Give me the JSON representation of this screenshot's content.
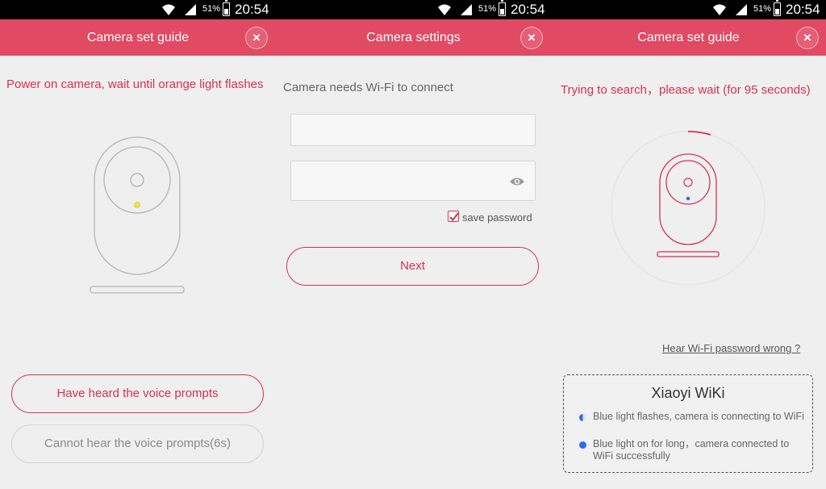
{
  "status_bar": {
    "battery": "51%",
    "time": "20:54"
  },
  "colors": {
    "accent": "#e04a63",
    "accent_text": "#d8314e",
    "indicator_blue": "#2a6de8",
    "indicator_yellow": "#f0e442"
  },
  "panels": [
    {
      "title": "Camera set guide",
      "close_icon": "×",
      "instruction": "Power on camera, wait until orange light flashes",
      "primary_button": "Have heard the voice prompts",
      "secondary_button": "Cannot hear the voice prompts(6s)"
    },
    {
      "title": "Camera settings",
      "close_icon": "×",
      "instruction": "Camera needs Wi-Fi to connect",
      "wifi_name_value": "",
      "password_value": "",
      "save_password_checked": true,
      "save_password_label": "save password",
      "next_button": "Next"
    },
    {
      "title": "Camera set guide",
      "close_icon": "×",
      "instruction": "Trying to search，please wait (for 95 seconds)",
      "help_link": "Hear Wi-Fi password wrong ?",
      "wiki": {
        "title": "Xiaoyi WiKi",
        "items": [
          {
            "icon": "half-blue-dot-icon",
            "text": "Blue light flashes, camera is connecting to WiFi"
          },
          {
            "icon": "blue-dot-icon",
            "text": "Blue light on for long，camera connected to WiFi successfully"
          }
        ]
      }
    }
  ]
}
